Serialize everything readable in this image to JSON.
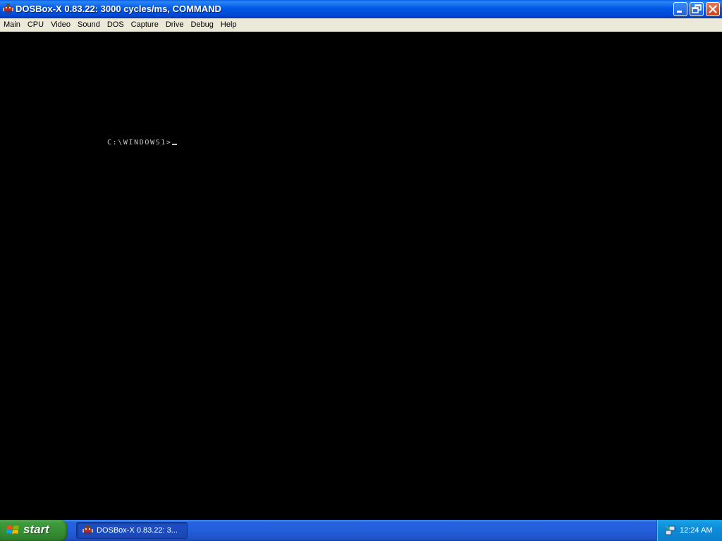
{
  "window": {
    "title": "DOSBox-X 0.83.22: 3000 cycles/ms, COMMAND",
    "icon": "dosbox-icon"
  },
  "menu": {
    "items": [
      {
        "label": "Main"
      },
      {
        "label": "CPU"
      },
      {
        "label": "Video"
      },
      {
        "label": "Sound"
      },
      {
        "label": "DOS"
      },
      {
        "label": "Capture"
      },
      {
        "label": "Drive"
      },
      {
        "label": "Debug"
      },
      {
        "label": "Help"
      }
    ]
  },
  "dos": {
    "prompt": "C:\\WINDOWS1>",
    "background_color": "#000000",
    "text_color": "#c8c8c8"
  },
  "taskbar": {
    "start_label": "start",
    "task_buttons": [
      {
        "label": "DOSBox-X 0.83.22: 3...",
        "icon": "dosbox-icon"
      }
    ],
    "clock": "12:24 AM",
    "tray_icon": "network-icon"
  },
  "colors": {
    "titlebar": "#0058e6",
    "menubar": "#ece9d8",
    "taskbar": "#245edb",
    "start_button": "#378f34",
    "tray": "#0f8cd8"
  }
}
